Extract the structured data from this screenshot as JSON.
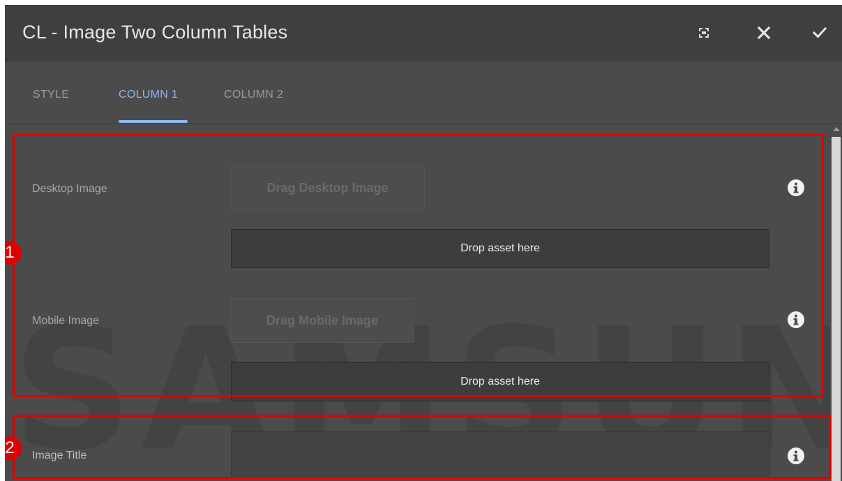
{
  "dialog": {
    "title": "CL - Image Two Column Tables",
    "actions": [
      {
        "name": "fullscreen",
        "icon": "fullscreen-icon"
      },
      {
        "name": "close",
        "icon": "close-icon"
      },
      {
        "name": "done",
        "icon": "checkmark-icon"
      }
    ]
  },
  "tabs": [
    {
      "label": "STYLE",
      "active": false
    },
    {
      "label": "COLUMN 1",
      "active": true
    },
    {
      "label": "COLUMN 2",
      "active": false
    }
  ],
  "fields": {
    "desktop_image": {
      "label": "Desktop Image",
      "drag_label": "Drag Desktop Image",
      "drop_label": "Drop asset here"
    },
    "mobile_image": {
      "label": "Mobile Image",
      "drag_label": "Drag Mobile Image",
      "drop_label": "Drop asset here"
    },
    "image_title": {
      "label": "Image Title",
      "value": ""
    }
  },
  "watermark": "SAMSUNG",
  "annotations": [
    {
      "number": "1"
    },
    {
      "number": "2"
    }
  ],
  "colors": {
    "header_bg": "#3f3f3f",
    "panel_bg": "#4b4b4b",
    "active_tab": "#8fb6ee",
    "annotation": "#e00000"
  }
}
